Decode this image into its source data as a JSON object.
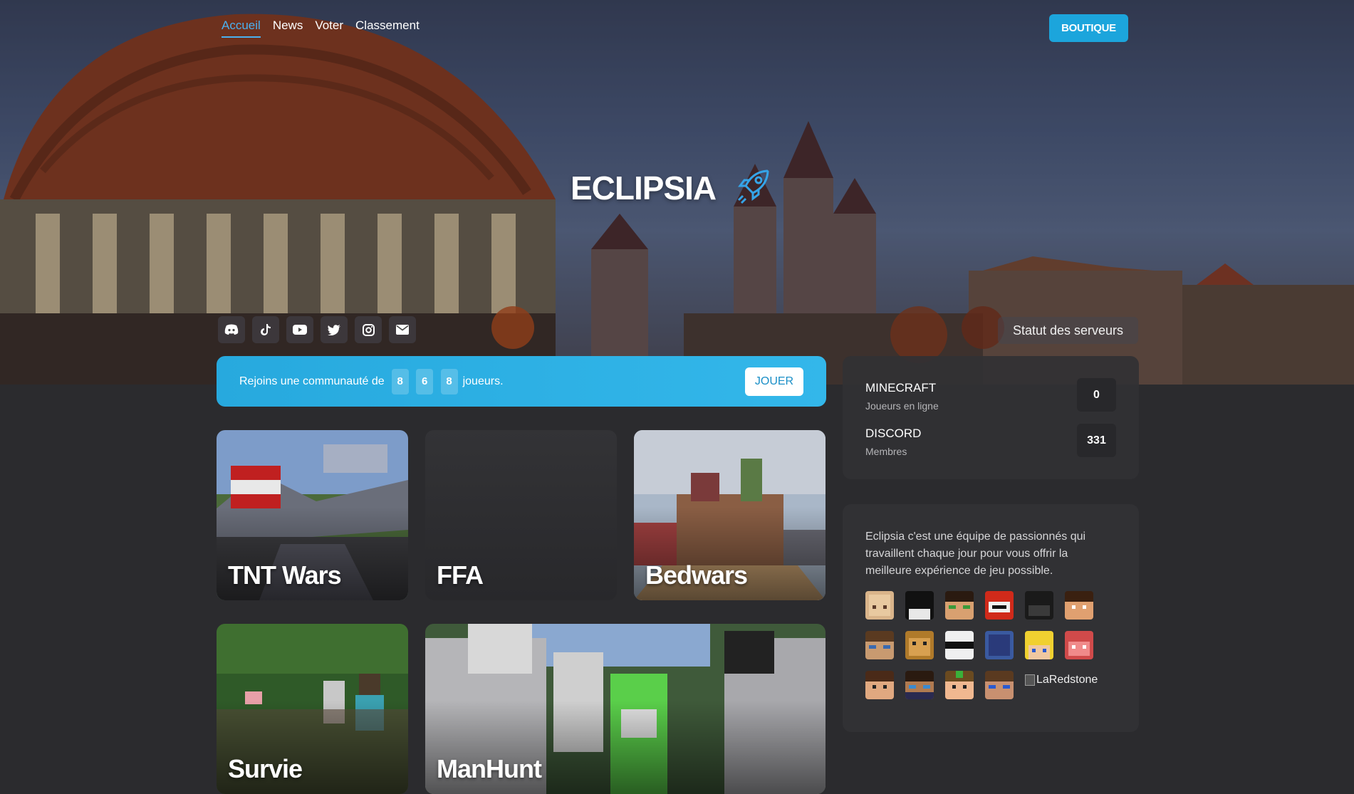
{
  "nav": {
    "items": [
      {
        "label": "Accueil",
        "active": true
      },
      {
        "label": "News",
        "active": false
      },
      {
        "label": "Voter",
        "active": false
      },
      {
        "label": "Classement",
        "active": false
      }
    ],
    "shop_label": "BOUTIQUE"
  },
  "hero": {
    "title": "ECLIPSIA",
    "title_icon": "rocket-icon"
  },
  "socials": [
    "discord-icon",
    "tiktok-icon",
    "youtube-icon",
    "twitter-icon",
    "instagram-icon",
    "mail-icon"
  ],
  "join": {
    "prefix": "Rejoins une communauté de",
    "digits": [
      "8",
      "6",
      "8"
    ],
    "suffix": "joueurs.",
    "button": "JOUER"
  },
  "games": {
    "tnt": "TNT Wars",
    "ffa": "FFA",
    "bedwars": "Bedwars",
    "survie": "Survie",
    "manhunt": "ManHunt"
  },
  "status": {
    "title": "Statut des serveurs",
    "servers": [
      {
        "name": "MINECRAFT",
        "sub": "Joueurs en ligne",
        "count": "0"
      },
      {
        "name": "DISCORD",
        "sub": "Membres",
        "count": "331"
      }
    ]
  },
  "about": {
    "text": "Eclipsia c'est une équipe de passionnés qui travaillent chaque jour pour vous offrir la meilleure expérience de jeu possible.",
    "broken_avatar_alt": "LaRedstone"
  },
  "colors": {
    "accent": "#1ca5dc",
    "background": "#2b2b2e",
    "panel": "#313134"
  }
}
